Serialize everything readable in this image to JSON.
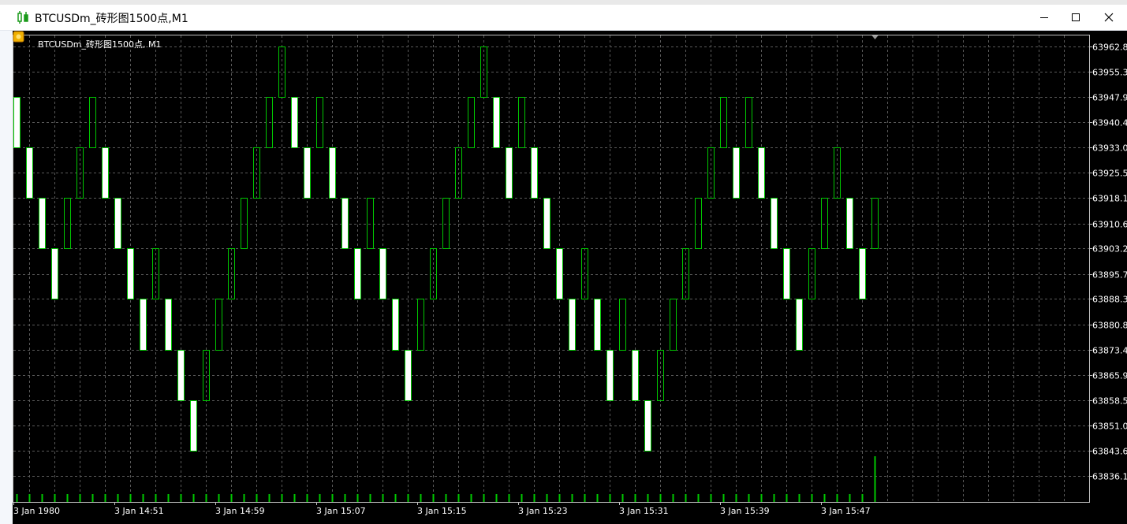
{
  "window": {
    "title": "BTCUSDm_砖形图1500点,M1",
    "minimize_label": "minimize",
    "maximize_label": "maximize",
    "close_label": "close"
  },
  "chart_label": "BTCUSDm_砖形图1500点, M1",
  "colors": {
    "background": "#000000",
    "grid": "#5a5a5a",
    "bull_outline": "#00c800",
    "bear_fill": "#ffffff",
    "bear_outline": "#00c800",
    "volume": "#00c800",
    "axis_text": "#ffffff"
  },
  "chart_data": {
    "type": "renko",
    "symbol": "BTCUSDm",
    "timeframe": "M1",
    "brick_size_points": 1500,
    "y_ticks": [
      "63962.8",
      "63955.3",
      "63947.9",
      "63940.4",
      "63933.0",
      "63925.5",
      "63918.1",
      "63910.6",
      "63903.2",
      "63895.7",
      "63888.3",
      "63880.8",
      "63873.4",
      "63865.9",
      "63858.5",
      "63851.0",
      "63843.6",
      "63836.1"
    ],
    "x_ticks": [
      "3 Jan 1980",
      "3 Jan 14:51",
      "3 Jan 14:59",
      "3 Jan 15:07",
      "3 Jan 15:15",
      "3 Jan 15:23",
      "3 Jan 15:31",
      "3 Jan 15:39",
      "3 Jan 15:47"
    ],
    "ylim": [
      63832,
      63965
    ],
    "bricks": [
      {
        "dir": "down",
        "low": 63933.0,
        "high": 63947.9
      },
      {
        "dir": "down",
        "low": 63918.1,
        "high": 63933.0
      },
      {
        "dir": "down",
        "low": 63903.2,
        "high": 63918.1
      },
      {
        "dir": "down",
        "low": 63888.3,
        "high": 63903.2
      },
      {
        "dir": "up",
        "low": 63903.2,
        "high": 63918.1
      },
      {
        "dir": "up",
        "low": 63918.1,
        "high": 63933.0
      },
      {
        "dir": "up",
        "low": 63933.0,
        "high": 63947.9
      },
      {
        "dir": "down",
        "low": 63918.1,
        "high": 63933.0
      },
      {
        "dir": "down",
        "low": 63903.2,
        "high": 63918.1
      },
      {
        "dir": "down",
        "low": 63888.3,
        "high": 63903.2
      },
      {
        "dir": "down",
        "low": 63873.4,
        "high": 63888.3
      },
      {
        "dir": "up",
        "low": 63888.3,
        "high": 63903.2
      },
      {
        "dir": "down",
        "low": 63873.4,
        "high": 63888.3
      },
      {
        "dir": "down",
        "low": 63858.5,
        "high": 63873.4
      },
      {
        "dir": "down",
        "low": 63843.6,
        "high": 63858.5
      },
      {
        "dir": "up",
        "low": 63858.5,
        "high": 63873.4
      },
      {
        "dir": "up",
        "low": 63873.4,
        "high": 63888.3
      },
      {
        "dir": "up",
        "low": 63888.3,
        "high": 63903.2
      },
      {
        "dir": "up",
        "low": 63903.2,
        "high": 63918.1
      },
      {
        "dir": "up",
        "low": 63918.1,
        "high": 63933.0
      },
      {
        "dir": "up",
        "low": 63933.0,
        "high": 63947.9
      },
      {
        "dir": "up",
        "low": 63947.9,
        "high": 63962.8
      },
      {
        "dir": "down",
        "low": 63933.0,
        "high": 63947.9
      },
      {
        "dir": "down",
        "low": 63918.1,
        "high": 63933.0
      },
      {
        "dir": "up",
        "low": 63933.0,
        "high": 63947.9
      },
      {
        "dir": "down",
        "low": 63918.1,
        "high": 63933.0
      },
      {
        "dir": "down",
        "low": 63903.2,
        "high": 63918.1
      },
      {
        "dir": "down",
        "low": 63888.3,
        "high": 63903.2
      },
      {
        "dir": "up",
        "low": 63903.2,
        "high": 63918.1
      },
      {
        "dir": "down",
        "low": 63888.3,
        "high": 63903.2
      },
      {
        "dir": "down",
        "low": 63873.4,
        "high": 63888.3
      },
      {
        "dir": "down",
        "low": 63858.5,
        "high": 63873.4
      },
      {
        "dir": "up",
        "low": 63873.4,
        "high": 63888.3
      },
      {
        "dir": "up",
        "low": 63888.3,
        "high": 63903.2
      },
      {
        "dir": "up",
        "low": 63903.2,
        "high": 63918.1
      },
      {
        "dir": "up",
        "low": 63918.1,
        "high": 63933.0
      },
      {
        "dir": "up",
        "low": 63933.0,
        "high": 63947.9
      },
      {
        "dir": "up",
        "low": 63947.9,
        "high": 63962.8
      },
      {
        "dir": "down",
        "low": 63933.0,
        "high": 63947.9
      },
      {
        "dir": "down",
        "low": 63918.1,
        "high": 63933.0
      },
      {
        "dir": "up",
        "low": 63933.0,
        "high": 63947.9
      },
      {
        "dir": "down",
        "low": 63918.1,
        "high": 63933.0
      },
      {
        "dir": "down",
        "low": 63903.2,
        "high": 63918.1
      },
      {
        "dir": "down",
        "low": 63888.3,
        "high": 63903.2
      },
      {
        "dir": "down",
        "low": 63873.4,
        "high": 63888.3
      },
      {
        "dir": "up",
        "low": 63888.3,
        "high": 63903.2
      },
      {
        "dir": "down",
        "low": 63873.4,
        "high": 63888.3
      },
      {
        "dir": "down",
        "low": 63858.5,
        "high": 63873.4
      },
      {
        "dir": "up",
        "low": 63873.4,
        "high": 63888.3
      },
      {
        "dir": "down",
        "low": 63858.5,
        "high": 63873.4
      },
      {
        "dir": "down",
        "low": 63843.6,
        "high": 63858.5
      },
      {
        "dir": "up",
        "low": 63858.5,
        "high": 63873.4
      },
      {
        "dir": "up",
        "low": 63873.4,
        "high": 63888.3
      },
      {
        "dir": "up",
        "low": 63888.3,
        "high": 63903.2
      },
      {
        "dir": "up",
        "low": 63903.2,
        "high": 63918.1
      },
      {
        "dir": "up",
        "low": 63918.1,
        "high": 63933.0
      },
      {
        "dir": "up",
        "low": 63933.0,
        "high": 63947.9
      },
      {
        "dir": "down",
        "low": 63918.1,
        "high": 63933.0
      },
      {
        "dir": "up",
        "low": 63933.0,
        "high": 63947.9
      },
      {
        "dir": "down",
        "low": 63918.1,
        "high": 63933.0
      },
      {
        "dir": "down",
        "low": 63903.2,
        "high": 63918.1
      },
      {
        "dir": "down",
        "low": 63888.3,
        "high": 63903.2
      },
      {
        "dir": "down",
        "low": 63873.4,
        "high": 63888.3
      },
      {
        "dir": "up",
        "low": 63888.3,
        "high": 63903.2
      },
      {
        "dir": "up",
        "low": 63903.2,
        "high": 63918.1
      },
      {
        "dir": "up",
        "low": 63918.1,
        "high": 63933.0
      },
      {
        "dir": "down",
        "low": 63903.2,
        "high": 63918.1
      },
      {
        "dir": "down",
        "low": 63888.3,
        "high": 63903.2
      },
      {
        "dir": "up",
        "low": 63903.2,
        "high": 63918.1
      }
    ],
    "volume_note": "tick volume bars at bottom, last bar taller"
  }
}
